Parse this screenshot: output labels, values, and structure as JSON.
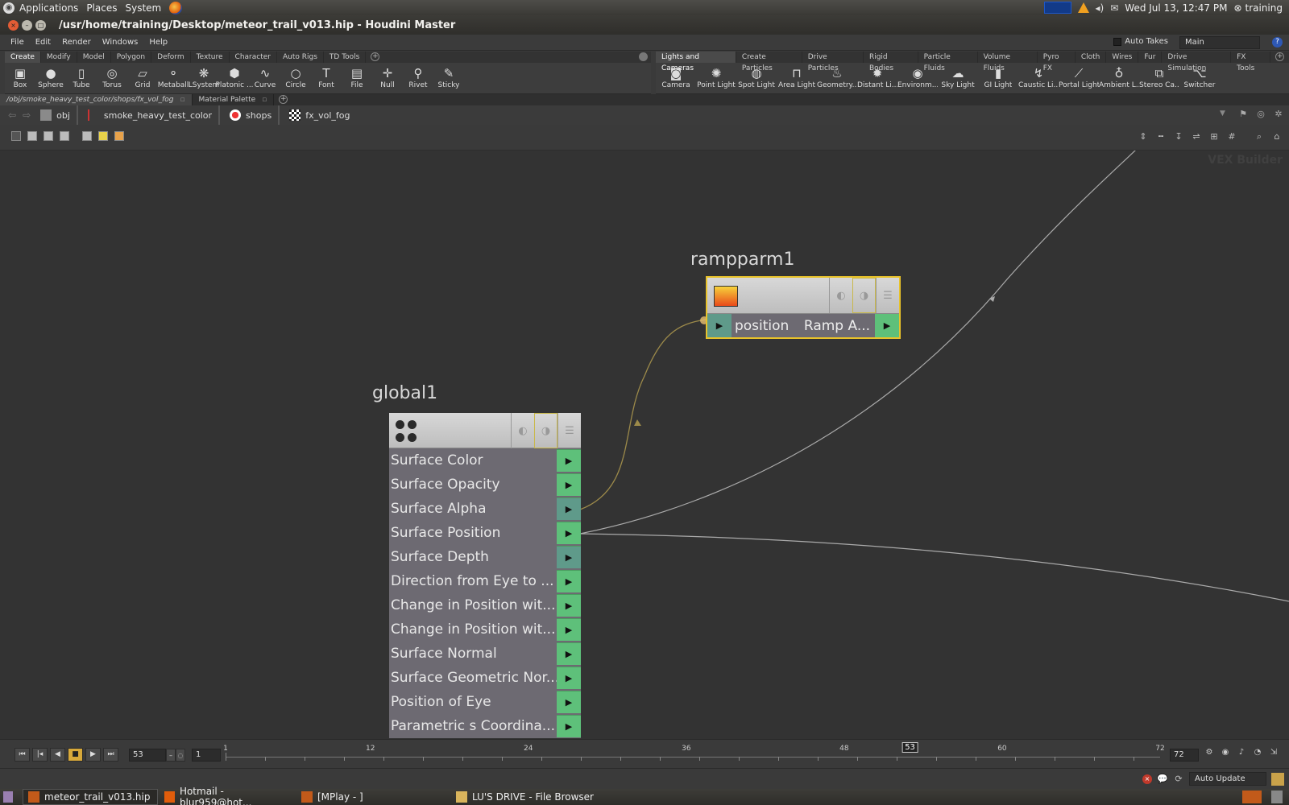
{
  "gnome_panel": {
    "menus": [
      "Applications",
      "Places",
      "System"
    ],
    "datetime": "Wed Jul 13, 12:47 PM",
    "user": "training"
  },
  "window": {
    "title": "/usr/home/training/Desktop/meteor_trail_v013.hip - Houdini Master"
  },
  "menubar": {
    "items": [
      "File",
      "Edit",
      "Render",
      "Windows",
      "Help"
    ],
    "auto_takes_label": "Auto Takes",
    "desktop": "Main"
  },
  "shelf_left": {
    "tabs": [
      "Create",
      "Modify",
      "Model",
      "Polygon",
      "Deform",
      "Texture",
      "Character",
      "Auto Rigs",
      "TD Tools"
    ],
    "tools": [
      {
        "label": "Box",
        "icon": "box-icon"
      },
      {
        "label": "Sphere",
        "icon": "sphere-icon"
      },
      {
        "label": "Tube",
        "icon": "tube-icon"
      },
      {
        "label": "Torus",
        "icon": "torus-icon"
      },
      {
        "label": "Grid",
        "icon": "grid-icon"
      },
      {
        "label": "Metaball",
        "icon": "metaball-icon"
      },
      {
        "label": "LSystem",
        "icon": "lsystem-icon"
      },
      {
        "label": "Platonic ...",
        "icon": "platonic-icon"
      },
      {
        "label": "Curve",
        "icon": "curve-icon"
      },
      {
        "label": "Circle",
        "icon": "circle-icon"
      },
      {
        "label": "Font",
        "icon": "font-icon"
      },
      {
        "label": "File",
        "icon": "file-icon"
      },
      {
        "label": "Null",
        "icon": "null-icon"
      },
      {
        "label": "Rivet",
        "icon": "rivet-icon"
      },
      {
        "label": "Sticky",
        "icon": "sticky-icon"
      }
    ]
  },
  "shelf_right": {
    "tabs": [
      "Lights and Cameras",
      "Create Particles",
      "Drive Particles",
      "Rigid Bodies",
      "Particle Fluids",
      "Volume Fluids",
      "Pyro FX",
      "Cloth",
      "Wires",
      "Fur",
      "Drive Simulation",
      "FX Tools"
    ],
    "tools": [
      {
        "label": "Camera",
        "icon": "camera-icon"
      },
      {
        "label": "Point Light",
        "icon": "point-light-icon"
      },
      {
        "label": "Spot Light",
        "icon": "spot-light-icon"
      },
      {
        "label": "Area Light",
        "icon": "area-light-icon"
      },
      {
        "label": "Geometry...",
        "icon": "geometry-light-icon"
      },
      {
        "label": "Distant Li...",
        "icon": "distant-light-icon"
      },
      {
        "label": "Environm...",
        "icon": "environment-light-icon"
      },
      {
        "label": "Sky Light",
        "icon": "sky-light-icon"
      },
      {
        "label": "GI Light",
        "icon": "gi-light-icon"
      },
      {
        "label": "Caustic Li...",
        "icon": "caustic-light-icon"
      },
      {
        "label": "Portal Light",
        "icon": "portal-light-icon"
      },
      {
        "label": "Ambient L...",
        "icon": "ambient-light-icon"
      },
      {
        "label": "Stereo Ca...",
        "icon": "stereo-camera-icon"
      },
      {
        "label": "Switcher",
        "icon": "switcher-icon"
      }
    ]
  },
  "pane_tabs": [
    "/obj/smoke_heavy_test_color/shops/fx_vol_fog",
    "Material Palette"
  ],
  "path": [
    "obj",
    "smoke_heavy_test_color",
    "shops",
    "fx_vol_fog"
  ],
  "network": {
    "context_label": "VEX Builder",
    "global_node": {
      "name": "global1",
      "outputs": [
        "Surface Color",
        "Surface Opacity",
        "Surface Alpha",
        "Surface Position",
        "Surface Depth",
        "Direction from Eye to ...",
        "Change in Position wit...",
        "Change in Position wit...",
        "Surface Normal",
        "Surface Geometric Nor...",
        "Position of Eye",
        "Parametric s Coordina..."
      ]
    },
    "ramp_node": {
      "name": "rampparm1",
      "input_label": "position",
      "output_label": "Ramp A..."
    }
  },
  "timeline": {
    "current_frame": "53",
    "start_frame": "1",
    "end_frame": "72",
    "ticks": [
      "1",
      "12",
      "24",
      "36",
      "48",
      "60",
      "72"
    ],
    "cursor": "53"
  },
  "statusbar": {
    "update_mode": "Auto Update"
  },
  "taskbar": {
    "tasks": [
      {
        "label": "meteor_trail_v013.hip",
        "active": true
      },
      {
        "label": "Hotmail - blur959@hot...",
        "active": false
      },
      {
        "label": "[MPlay - ]",
        "active": false
      },
      {
        "label": "LU'S DRIVE - File Browser",
        "active": false
      }
    ]
  }
}
